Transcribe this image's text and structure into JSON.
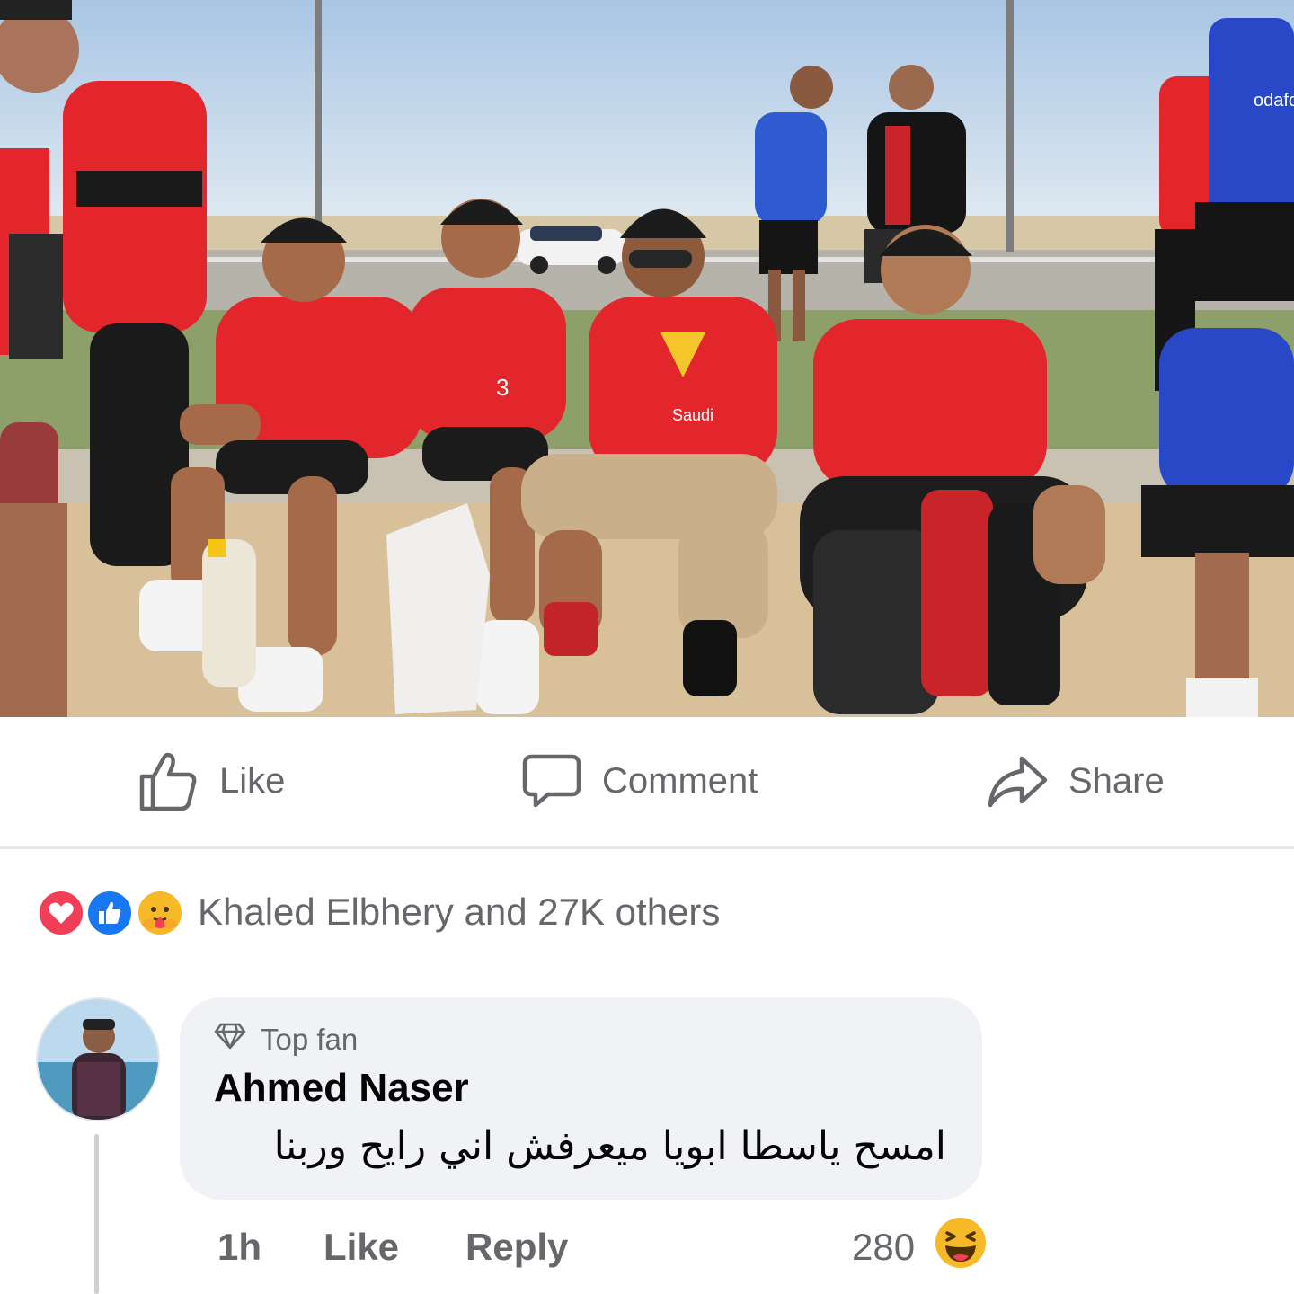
{
  "photo": {
    "jersey_texts": [
      "3",
      "Saudi",
      "odafo"
    ]
  },
  "actions": {
    "like_label": "Like",
    "comment_label": "Comment",
    "share_label": "Share"
  },
  "reactions": {
    "types": [
      "love",
      "like",
      "care"
    ],
    "summary": "Khaled Elbhery and 27K others"
  },
  "comment": {
    "badge": "Top fan",
    "author": "Ahmed Naser",
    "text": "امسح ياسطا ابويا ميعرفش اني رايح وربنا",
    "time": "1h",
    "like_label": "Like",
    "reply_label": "Reply",
    "reaction_count": "280",
    "reaction_type": "haha"
  },
  "colors": {
    "jersey_red": "#e3262b",
    "like_blue": "#1877f2",
    "love_red": "#f33e58",
    "care_yellow": "#f7b928",
    "muted_text": "#65676b",
    "bubble_bg": "#f0f2f5"
  }
}
